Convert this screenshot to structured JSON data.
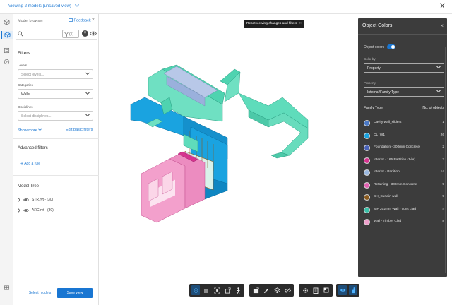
{
  "header": {
    "title": "Viewing 2 models (unsaved view)",
    "close": "X"
  },
  "model_browser": {
    "title": "Model browser",
    "feedback": "Feedback",
    "filter_count": "(1)",
    "clear": "×",
    "filters_heading": "Filters",
    "levels": {
      "label": "Levels",
      "placeholder": "Select levels..."
    },
    "categories": {
      "label": "Categories",
      "value": "Walls"
    },
    "disciplines": {
      "label": "Disciplines",
      "placeholder": "Select disciplines..."
    },
    "show_more": "Show more",
    "edit_basic": "Edit basic filters",
    "advanced_heading": "Advanced filters",
    "add_rule": "Add a rule",
    "tree_heading": "Model Tree",
    "tree_items": [
      {
        "label": "STR.rvt - (30)"
      },
      {
        "label": "ARC.rvt - (30)"
      }
    ],
    "select_models": "Select models",
    "save_view": "Save view"
  },
  "viewport": {
    "reset_tooltip": "Reset viewing changes and filters"
  },
  "object_colors": {
    "title": "Object Colors",
    "toggle_label": "Object colors",
    "color_by_label": "Color by",
    "color_by_value": "Property",
    "property_label": "Property",
    "property_value": "Internal/Family Type",
    "col_family": "Family Type",
    "col_count": "No. of objects",
    "rows": [
      {
        "name": "Cavity wall_sliders",
        "count": "1",
        "color": "#4a78c4"
      },
      {
        "name": "CL_W1",
        "count": "26",
        "color": "#1aa3e0"
      },
      {
        "name": "Foundation - 300mm Concrete",
        "count": "2",
        "color": "#4a63b8"
      },
      {
        "name": "Interior - 165 Partition (1-hr)",
        "count": "3",
        "color": "#d6338f"
      },
      {
        "name": "Interior - Partition",
        "count": "14",
        "color": "#9ab8e0"
      },
      {
        "name": "Retaining - 300mm Concrete",
        "count": "9",
        "color": "#e060b0"
      },
      {
        "name": "SH_Curtain wall",
        "count": "9",
        "color": "#8a5a1e"
      },
      {
        "name": "SIP 202mm Wall - conc clad",
        "count": "4",
        "color": "#3cc0a8"
      },
      {
        "name": "Wall - Timber Clad",
        "count": "8",
        "color": "#f0a0cc"
      }
    ]
  },
  "colors": {
    "accent": "#1976d2",
    "panel_dark": "#3c3c3c",
    "toolbar": "#2b2b2b"
  }
}
